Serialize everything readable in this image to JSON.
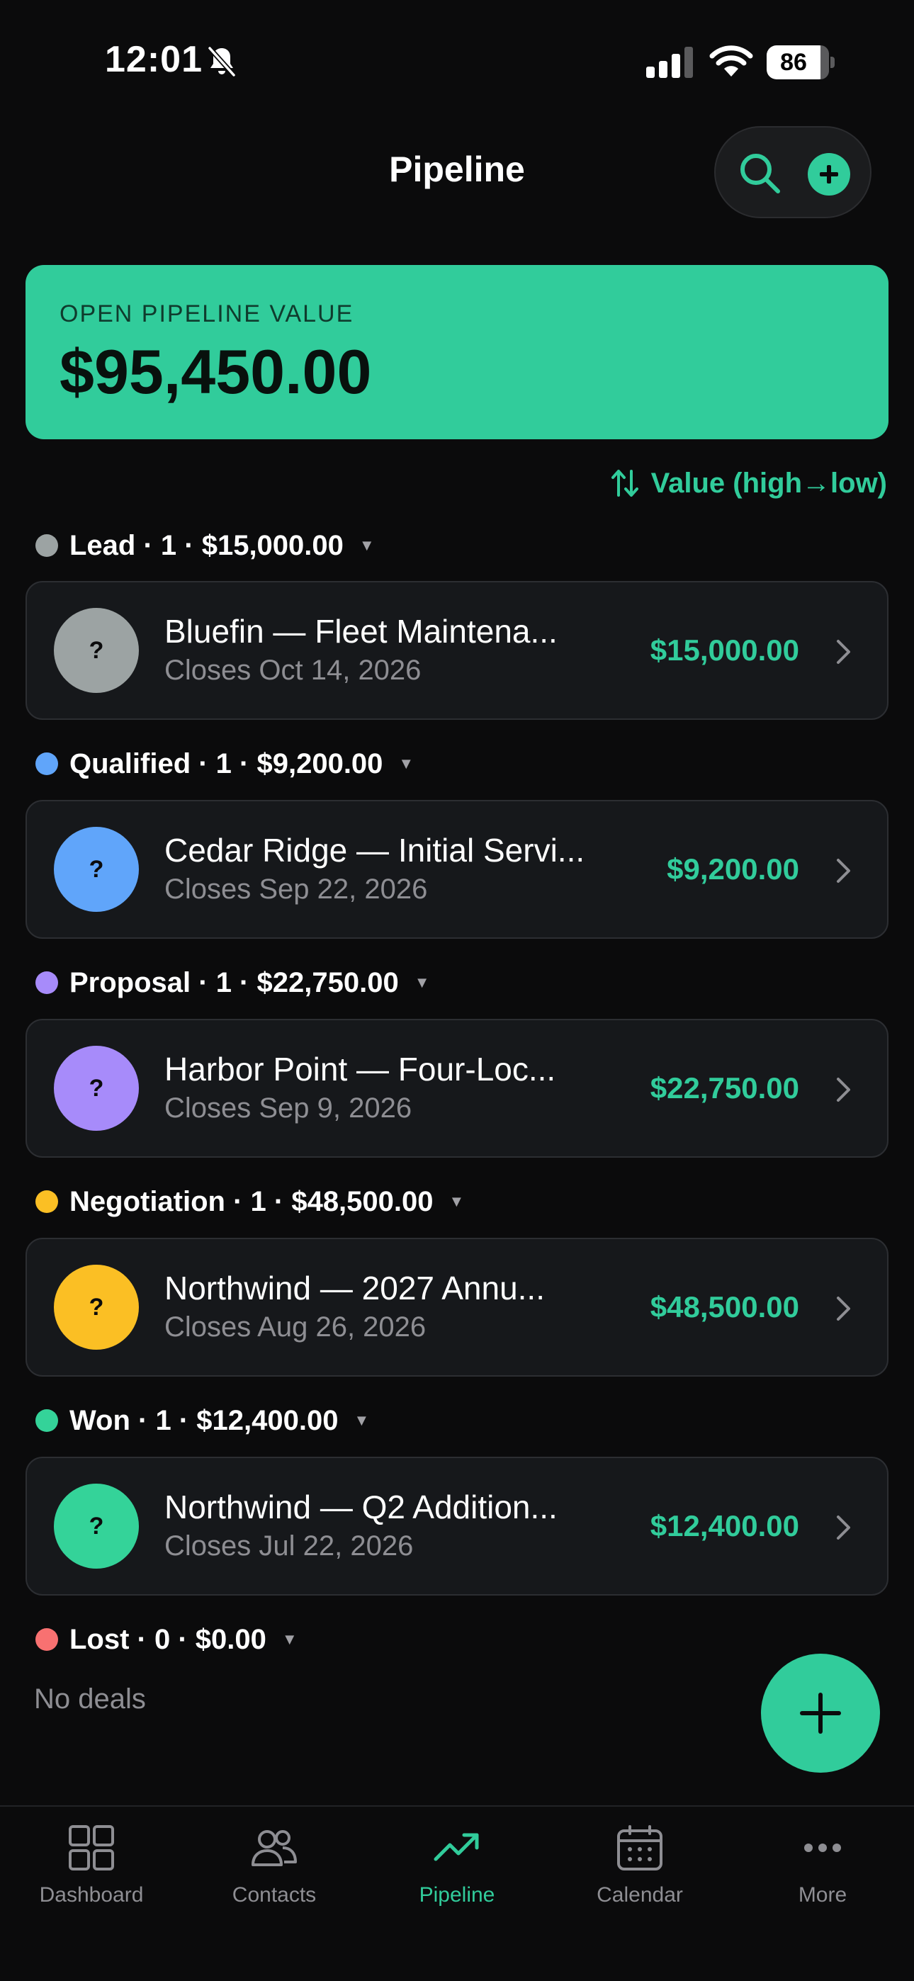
{
  "status_bar": {
    "time": "12:01",
    "battery": "86"
  },
  "header": {
    "title": "Pipeline",
    "search_icon": "search-icon",
    "add_icon": "plus-circle-icon"
  },
  "summary": {
    "label": "OPEN PIPELINE VALUE",
    "value": "$95,450.00"
  },
  "sort": {
    "label": "Value (high→low)"
  },
  "colors": {
    "accent": "#31cc9b",
    "lead": "#9ca3a3",
    "qualified": "#60a5fa",
    "proposal": "#a78bfa",
    "negotiation": "#fbbf24",
    "won": "#34d399",
    "lost": "#f87171"
  },
  "groups": [
    {
      "header": "Lead · 1 · $15,000.00",
      "deal": {
        "avatar": "?",
        "title": "Bluefin — Fleet Maintena...",
        "date": "Closes Oct 14, 2026",
        "amount": "$15,000.00"
      }
    },
    {
      "header": "Qualified · 1 · $9,200.00",
      "deal": {
        "avatar": "?",
        "title": "Cedar Ridge — Initial Servi...",
        "date": "Closes Sep 22, 2026",
        "amount": "$9,200.00"
      }
    },
    {
      "header": "Proposal · 1 · $22,750.00",
      "deal": {
        "avatar": "?",
        "title": "Harbor Point — Four-Loc...",
        "date": "Closes Sep 9, 2026",
        "amount": "$22,750.00"
      }
    },
    {
      "header": "Negotiation · 1 · $48,500.00",
      "deal": {
        "avatar": "?",
        "title": "Northwind — 2027 Annu...",
        "date": "Closes Aug 26, 2026",
        "amount": "$48,500.00"
      }
    },
    {
      "header": "Won · 1 · $12,400.00",
      "deal": {
        "avatar": "?",
        "title": "Northwind — Q2 Addition...",
        "date": "Closes Jul 22, 2026",
        "amount": "$12,400.00"
      }
    },
    {
      "header": "Lost · 0 · $0.00",
      "empty_text": "No deals"
    }
  ],
  "tabs": [
    {
      "label": "Dashboard",
      "icon": "grid-icon"
    },
    {
      "label": "Contacts",
      "icon": "people-icon"
    },
    {
      "label": "Pipeline",
      "icon": "trend-up-icon",
      "active": true
    },
    {
      "label": "Calendar",
      "icon": "calendar-icon"
    },
    {
      "label": "More",
      "icon": "more-icon"
    }
  ]
}
